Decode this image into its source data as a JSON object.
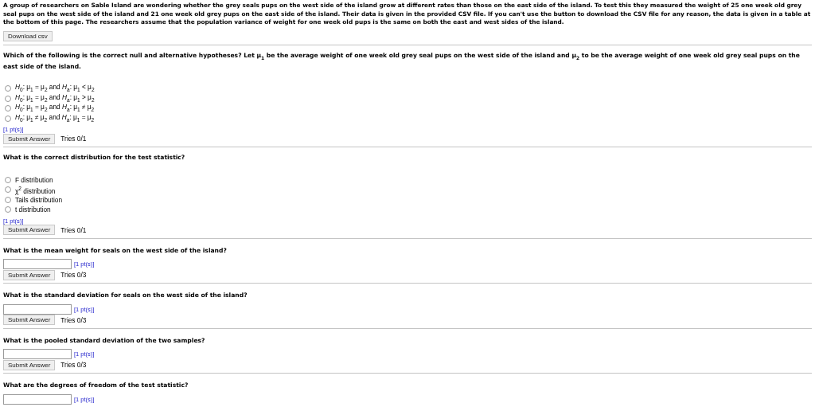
{
  "intro": "A group of researchers on Sable Island are wondering whether the grey seals pups on the west side of the island grow at different rates than those on the east side of the island. To test this they measured the weight of 25 one week old grey seal pups on the west side of the island and 21 one week old grey pups on the east side of the island. Their data is given in the provided CSV file. If you can't use the button to download the CSV file for any reason, the data is given in a table at the bottom of this page. The researchers assume that the population variance of weight for one week old pups is the same on both the east and west sides of the island.",
  "download_button": "Download csv",
  "questions": [
    {
      "kind": "choice",
      "prompt": "Which of the following is the correct null and alternative hypotheses? Let μ$_{1}$ be the average weight of one week old grey seal pups on the west side of the island and μ$_{2}$ to be the average weight of one week old grey seal pups on the east side of the island.",
      "options": [
        {
          "label": "*H*$_{0}$: μ$_{1}$ = μ$_{2}$ and *H*$_{a}$: μ$_{1}$ < μ$_{2}$",
          "selected": false
        },
        {
          "label": "*H*$_{0}$: μ$_{1}$ = μ$_{2}$ and *H*$_{a}$: μ$_{1}$ > μ$_{2}$",
          "selected": false
        },
        {
          "label": "*H*$_{0}$: μ$_{1}$ = μ$_{2}$ and *H*$_{a}$: μ$_{1}$ ≠ μ$_{2}$",
          "selected": false
        },
        {
          "label": "*H*$_{0}$: μ$_{1}$ ≠ μ$_{2}$ and *H*$_{a}$: μ$_{1}$ = μ$_{2}$",
          "selected": false
        }
      ],
      "points": "[1 pt(s)]",
      "submit": "Submit Answer",
      "tries": "Tries 0/1"
    },
    {
      "kind": "choice",
      "prompt": "What is the correct distribution for the test statistic?",
      "options": [
        {
          "label": "F distribution",
          "selected": false
        },
        {
          "label": "χ$^{2}$ distribution",
          "selected": false
        },
        {
          "label": "Tails distribution",
          "selected": false
        },
        {
          "label": "t distribution",
          "selected": false
        }
      ],
      "points": "[1 pt(s)]",
      "submit": "Submit Answer",
      "tries": "Tries 0/1"
    },
    {
      "kind": "input",
      "prompt": "What is the mean weight for seals on the west side of the island?",
      "points": "[1 pt(s)]",
      "submit": "Submit Answer",
      "tries": "Tries 0/3"
    },
    {
      "kind": "input",
      "prompt": "What is the standard deviation for seals on the west side of the island?",
      "points": "[1 pt(s)]",
      "submit": "Submit Answer",
      "tries": "Tries 0/3"
    },
    {
      "kind": "input",
      "prompt": "What is the pooled standard deviation of the two samples?",
      "points": "[1 pt(s)]",
      "submit": "Submit Answer",
      "tries": "Tries 0/3"
    },
    {
      "kind": "input",
      "prompt": "What are the degrees of freedom of the test statistic?",
      "points": "[1 pt(s)]"
    }
  ]
}
